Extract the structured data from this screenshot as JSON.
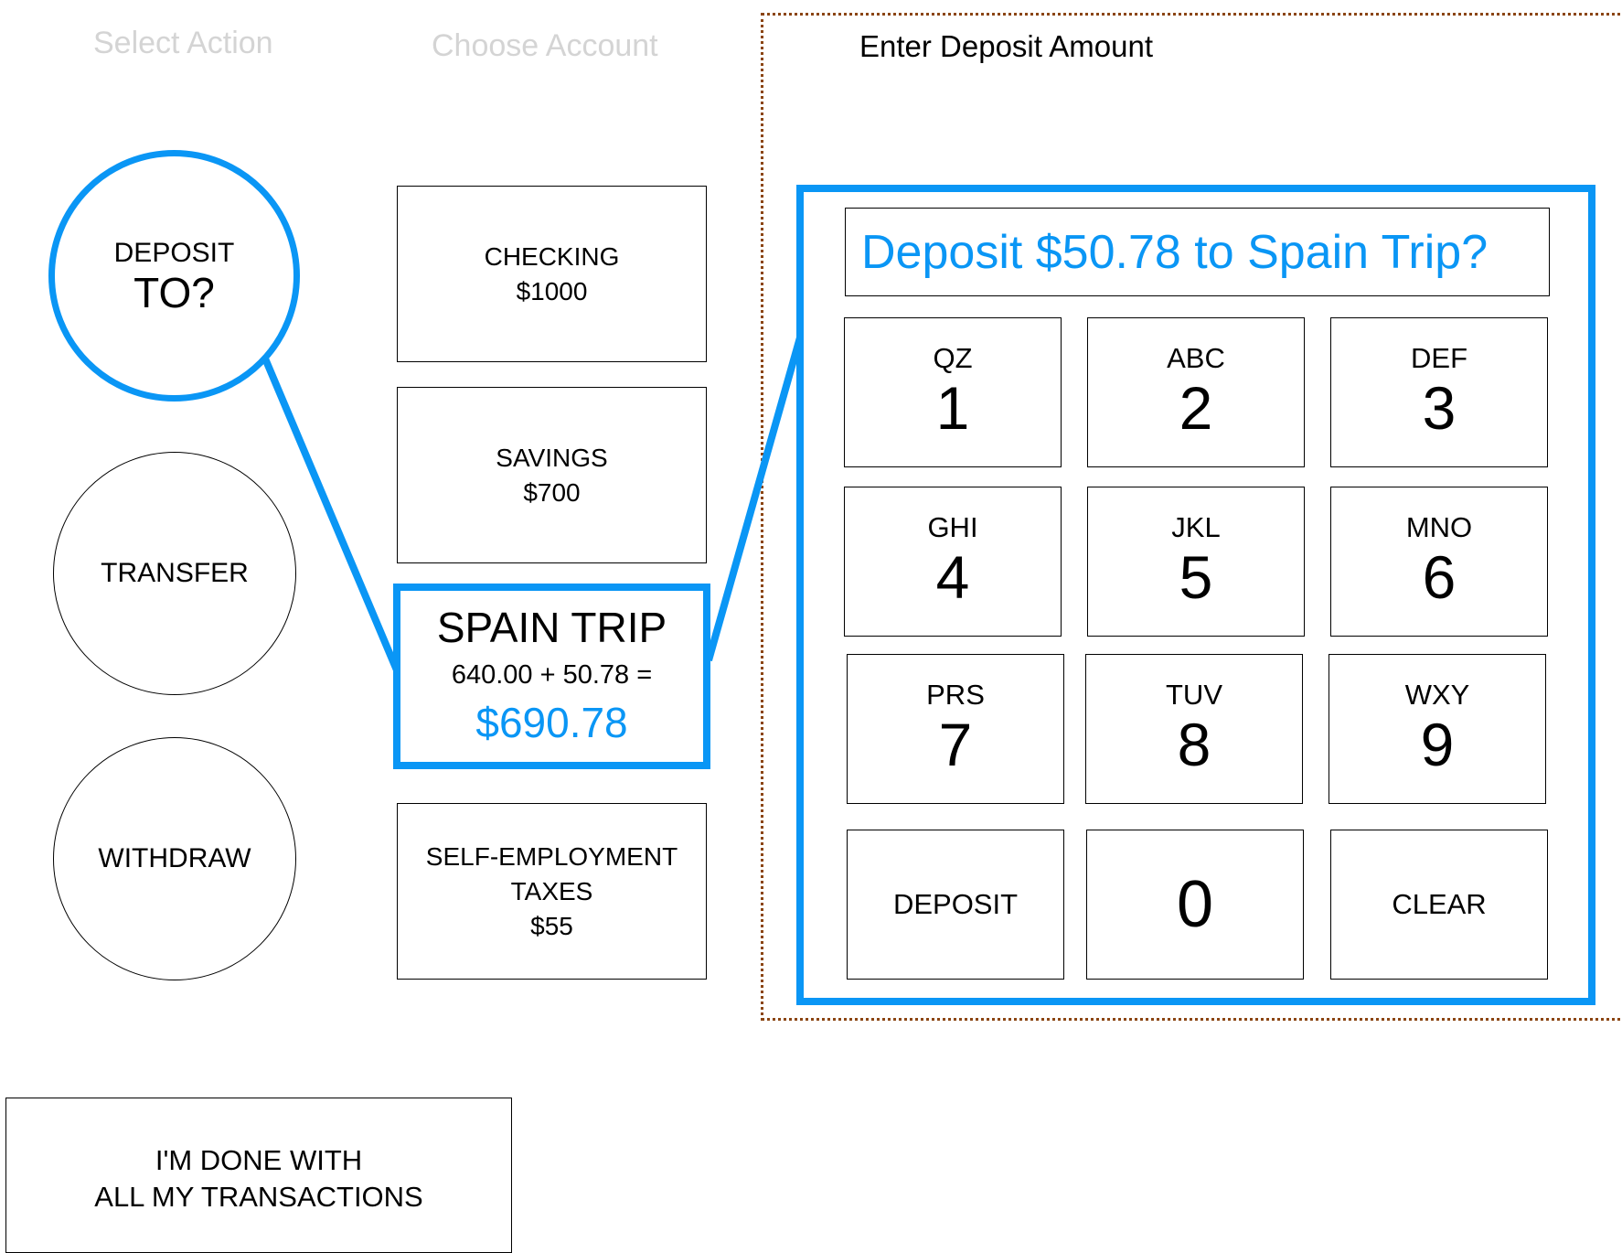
{
  "headers": {
    "select_action": "Select Action",
    "choose_account": "Choose Account",
    "enter_amount": "Enter Deposit Amount"
  },
  "actions": [
    {
      "line1": "DEPOSIT",
      "line2": "TO?",
      "selected": true
    },
    {
      "line1": "TRANSFER",
      "line2": "",
      "selected": false
    },
    {
      "line1": "WITHDRAW",
      "line2": "",
      "selected": false
    }
  ],
  "accounts": {
    "checking": {
      "name": "CHECKING",
      "balance": "$1000"
    },
    "savings": {
      "name": "SAVINGS",
      "balance": "$700"
    },
    "spain_trip": {
      "name": "SPAIN TRIP",
      "calculation": "640.00 + 50.78 =",
      "new_balance": "$690.78"
    },
    "taxes": {
      "name_line1": "SELF-EMPLOYMENT",
      "name_line2": "TAXES",
      "balance": "$55"
    }
  },
  "keypad": {
    "confirmation": "Deposit $50.78 to Spain Trip?",
    "keys": [
      {
        "letters": "QZ",
        "digit": "1"
      },
      {
        "letters": "ABC",
        "digit": "2"
      },
      {
        "letters": "DEF",
        "digit": "3"
      },
      {
        "letters": "GHI",
        "digit": "4"
      },
      {
        "letters": "JKL",
        "digit": "5"
      },
      {
        "letters": "MNO",
        "digit": "6"
      },
      {
        "letters": "PRS",
        "digit": "7"
      },
      {
        "letters": "TUV",
        "digit": "8"
      },
      {
        "letters": "WXY",
        "digit": "9"
      }
    ],
    "deposit_label": "DEPOSIT",
    "zero": "0",
    "clear_label": "CLEAR"
  },
  "done": {
    "line1": "I'M DONE WITH",
    "line2": "ALL MY TRANSACTIONS"
  },
  "colors": {
    "accent": "#0a96f5",
    "dotted_border": "#8b4513",
    "dim_header": "#d4d4d4"
  }
}
